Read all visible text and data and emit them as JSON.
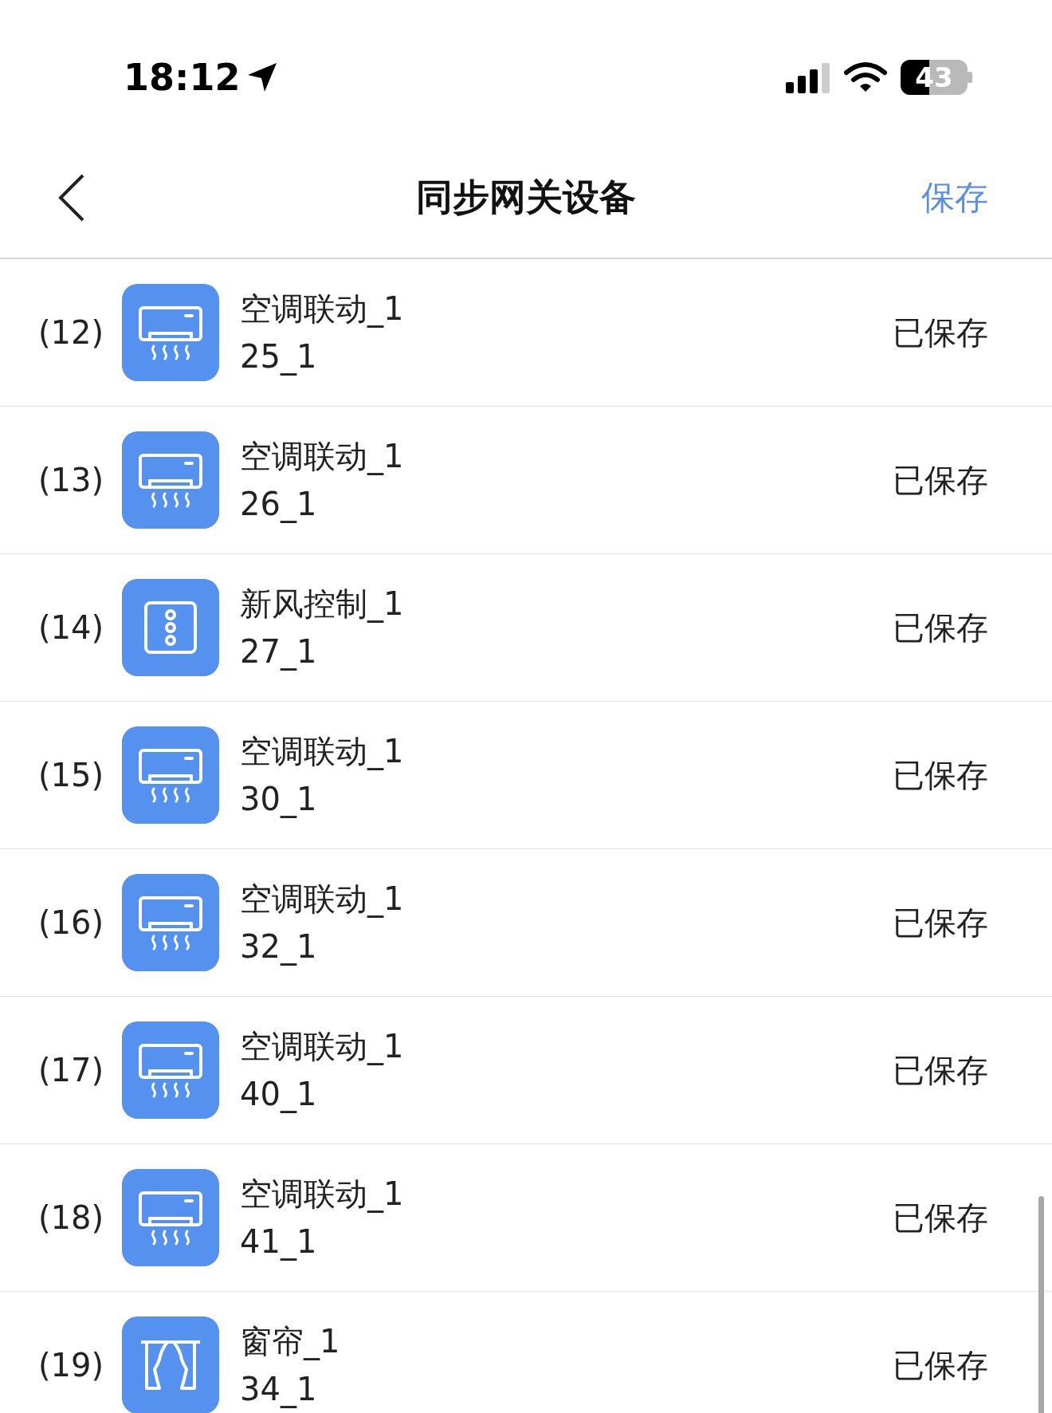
{
  "status_bar": {
    "time": "18:12",
    "battery": "43"
  },
  "nav": {
    "title": "同步网关设备",
    "action": "保存"
  },
  "devices": [
    {
      "index": "(12)",
      "kind": "ac",
      "name": "空调联动_1",
      "code": "25_1",
      "status": "已保存"
    },
    {
      "index": "(13)",
      "kind": "ac",
      "name": "空调联动_1",
      "code": "26_1",
      "status": "已保存"
    },
    {
      "index": "(14)",
      "kind": "fresh_air",
      "name": "新风控制_1",
      "code": "27_1",
      "status": "已保存"
    },
    {
      "index": "(15)",
      "kind": "ac",
      "name": "空调联动_1",
      "code": "30_1",
      "status": "已保存"
    },
    {
      "index": "(16)",
      "kind": "ac",
      "name": "空调联动_1",
      "code": "32_1",
      "status": "已保存"
    },
    {
      "index": "(17)",
      "kind": "ac",
      "name": "空调联动_1",
      "code": "40_1",
      "status": "已保存"
    },
    {
      "index": "(18)",
      "kind": "ac",
      "name": "空调联动_1",
      "code": "41_1",
      "status": "已保存"
    },
    {
      "index": "(19)",
      "kind": "curtain",
      "name": "窗帘_1",
      "code": "34_1",
      "status": "已保存"
    }
  ]
}
